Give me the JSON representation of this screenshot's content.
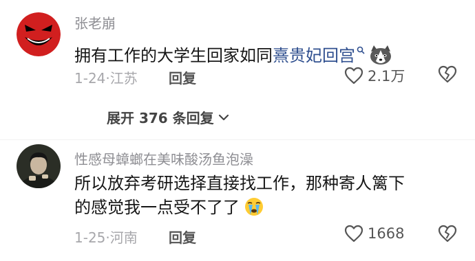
{
  "comments": [
    {
      "username": "张老崩",
      "text_plain": "拥有工作的大学生回家如同",
      "text_link": "熹贵妃回宫",
      "date": "1-24",
      "location": "江苏",
      "reply_label": "回复",
      "like_count": "2.1万"
    },
    {
      "username": "性感母蟑螂在美味酸汤鱼泡澡",
      "text_line1": "所以放弃考研选择直接找工作，那种寄人篱下",
      "text_line2": "的感觉我一点受不了了",
      "date": "1-25",
      "location": "河南",
      "reply_label": "回复",
      "like_count": "1668"
    }
  ],
  "expand_replies": {
    "label": "展开 376 条回复"
  },
  "separator": "·",
  "colors": {
    "link": "#2f4f8f",
    "meta": "#a7a7ab",
    "username": "#8e8e93"
  },
  "icons": {
    "avatar1": "evil-smiley",
    "emoji1": "husky-dog",
    "emoji2": "crying-face",
    "like": "heart-outline",
    "dislike": "broken-heart",
    "search": "search",
    "chevron": "chevron-down"
  }
}
